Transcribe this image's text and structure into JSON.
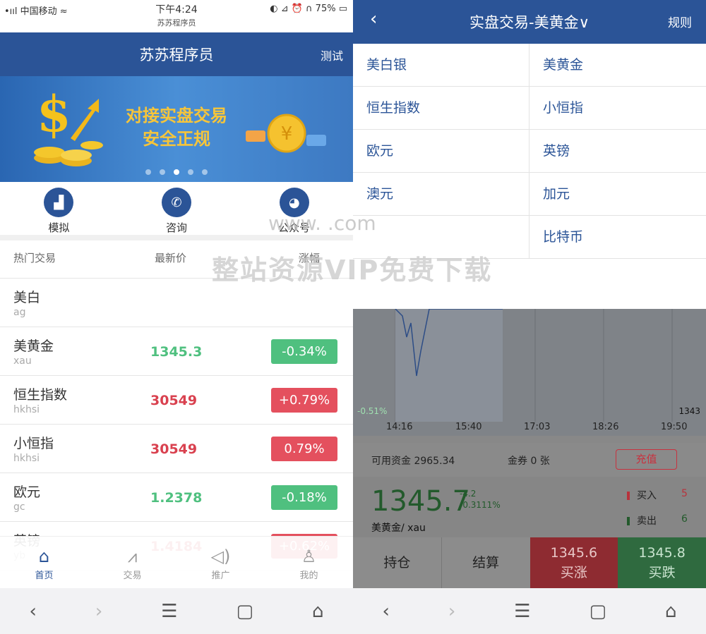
{
  "left": {
    "status": {
      "carrier": "•ııl 中国移动 ≈",
      "time": "下午4:24",
      "subtitle": "苏苏程序员",
      "right": "◐ ⊿ ⏰ ∩ 75% ▭"
    },
    "title": "苏苏程序员",
    "test_link": "测试",
    "banner": {
      "line1": "对接实盘交易",
      "line2": "安全正规"
    },
    "quick": [
      {
        "label": "模拟",
        "icon": "chart-icon"
      },
      {
        "label": "咨询",
        "icon": "phone-icon"
      },
      {
        "label": "公众号",
        "icon": "wechat-icon"
      }
    ],
    "list_header": {
      "name": "热门交易",
      "price": "最新价",
      "change": "涨幅"
    },
    "rows": [
      {
        "name": "美白",
        "code": "ag",
        "price": "",
        "change": "",
        "dir": ""
      },
      {
        "name": "美黄金",
        "code": "xau",
        "price": "1345.3",
        "change": "-0.34%",
        "dir": "dn"
      },
      {
        "name": "恒生指数",
        "code": "hkhsi",
        "price": "30549",
        "change": "+0.79%",
        "dir": "up"
      },
      {
        "name": "小恒指",
        "code": "hkhsi",
        "price": "30549",
        "change": "0.79%",
        "dir": "up"
      },
      {
        "name": "欧元",
        "code": "gc",
        "price": "1.2378",
        "change": "-0.18%",
        "dir": "dn"
      },
      {
        "name": "英镑",
        "code": "yb",
        "price": "1.4184",
        "change": "+0.62%",
        "dir": "up"
      }
    ],
    "tabs": [
      {
        "label": "首页",
        "icon": "home-icon"
      },
      {
        "label": "交易",
        "icon": "trade-icon"
      },
      {
        "label": "推广",
        "icon": "speaker-icon"
      },
      {
        "label": "我的",
        "icon": "user-icon"
      }
    ]
  },
  "right": {
    "title": "实盘交易-美黄金∨",
    "rules": "规则",
    "products": [
      "美白银",
      "美黄金",
      "恒生指数",
      "小恒指",
      "欧元",
      "英镑",
      "澳元",
      "加元",
      "",
      "比特币"
    ],
    "chart": {
      "left_label": "-0.51%",
      "right_label": "1343",
      "times": [
        "14:16",
        "15:40",
        "17:03",
        "18:26",
        "19:50"
      ]
    },
    "fund": {
      "available": "可用资金 2965.34",
      "coupon": "金券 0 张",
      "recharge": "充值"
    },
    "quote": {
      "price": "1345.7",
      "delta": "-4.2",
      "pct": "-0.3111%",
      "symbol": "美黄金/ xau",
      "buy_label": "买入",
      "buy_val": "5",
      "sell_label": "卖出",
      "sell_val": "6"
    },
    "actions": {
      "hold": "持仓",
      "settle": "结算",
      "up_price": "1345.6",
      "up_label": "买涨",
      "dn_price": "1345.8",
      "dn_label": "买跌"
    }
  },
  "watermark": {
    "line1": "www.        .com",
    "line2": "整站资源VIP免费下载"
  }
}
